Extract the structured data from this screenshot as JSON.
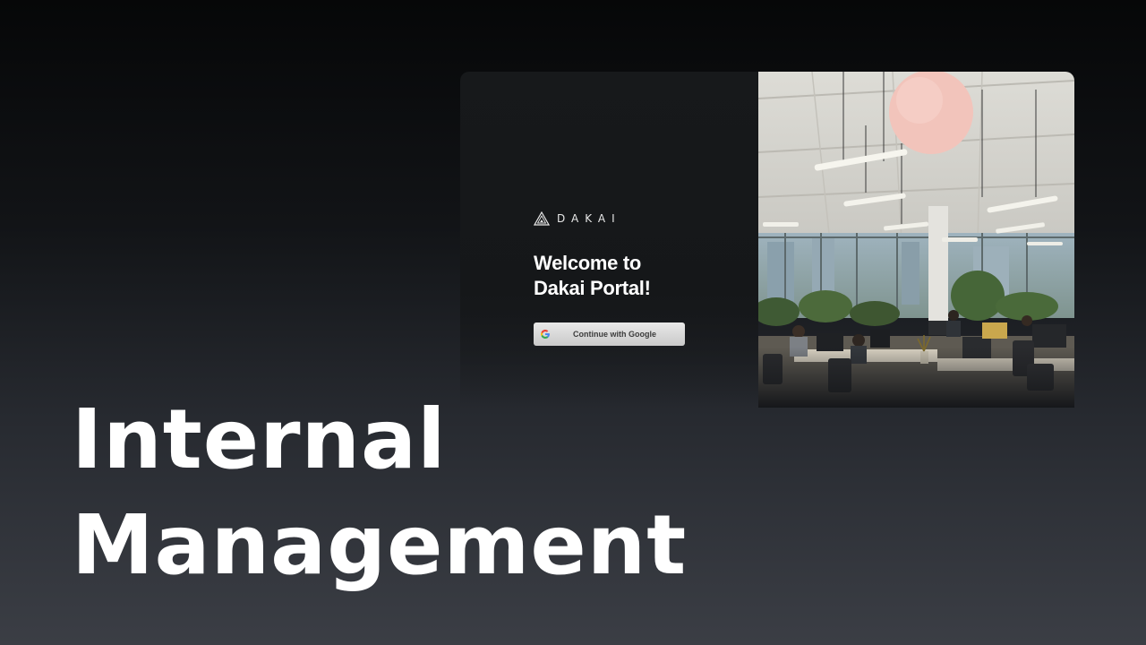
{
  "brand": {
    "name": "DAKAI",
    "logo_icon": "triangle-logo-icon"
  },
  "login": {
    "welcome_line1": "Welcome to",
    "welcome_line2": "Dakai Portal!",
    "google_button_label": "Continue with Google",
    "google_icon": "google-g-icon"
  },
  "hero_image": {
    "subject": "open-plan office photo",
    "accent_lamp_color": "#f2c4bb"
  },
  "headline": {
    "line1": "Internal",
    "line2": "Management"
  },
  "colors": {
    "background_top": "#060708",
    "background_bottom": "#3b3e45",
    "card_panel": "#17191b",
    "text": "#ffffff"
  }
}
